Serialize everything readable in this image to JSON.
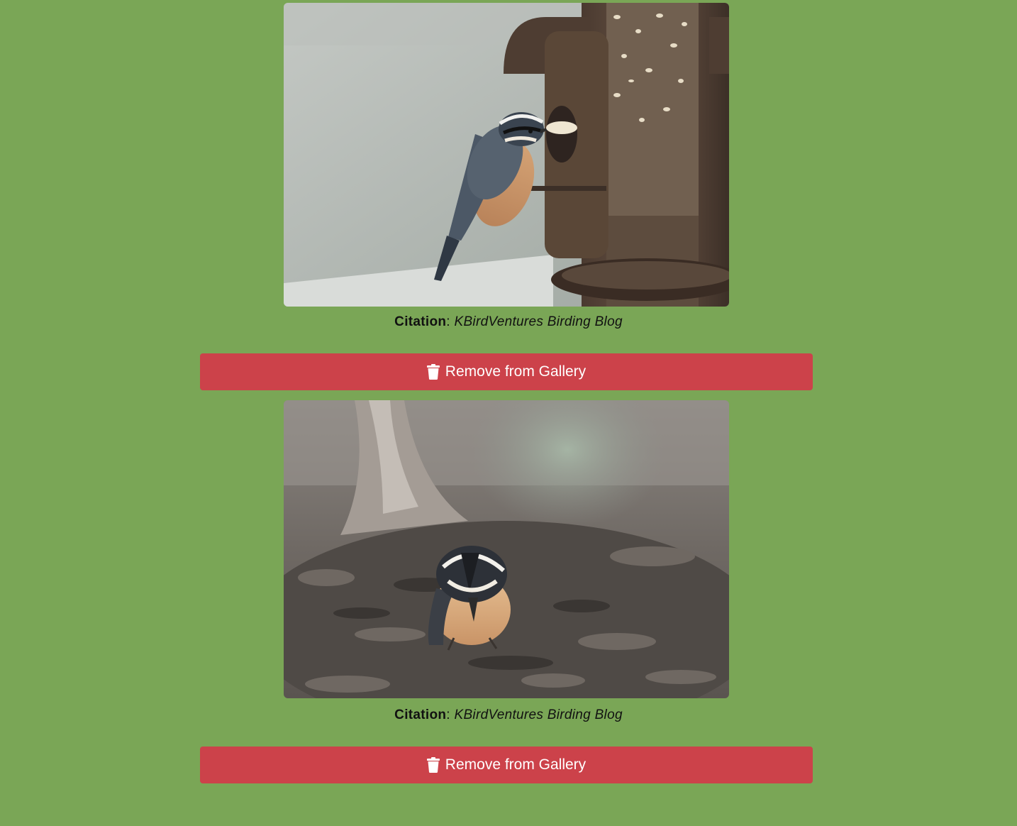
{
  "colors": {
    "background": "#7aa656",
    "button": "#cc424a",
    "button_text": "#ffffff"
  },
  "gallery": {
    "items": [
      {
        "image_alt": "Red-breasted nuthatch eating seeds at a bird feeder",
        "citation_label": "Citation",
        "citation_separator": ":",
        "citation_source": "KBirdVentures Birding Blog",
        "remove_icon": "trash-icon",
        "remove_label": "Remove from Gallery"
      },
      {
        "image_alt": "Red-breasted nuthatch foraging on the ground among bark",
        "citation_label": "Citation",
        "citation_separator": ":",
        "citation_source": "KBirdVentures Birding Blog",
        "remove_icon": "trash-icon",
        "remove_label": "Remove from Gallery"
      }
    ]
  }
}
